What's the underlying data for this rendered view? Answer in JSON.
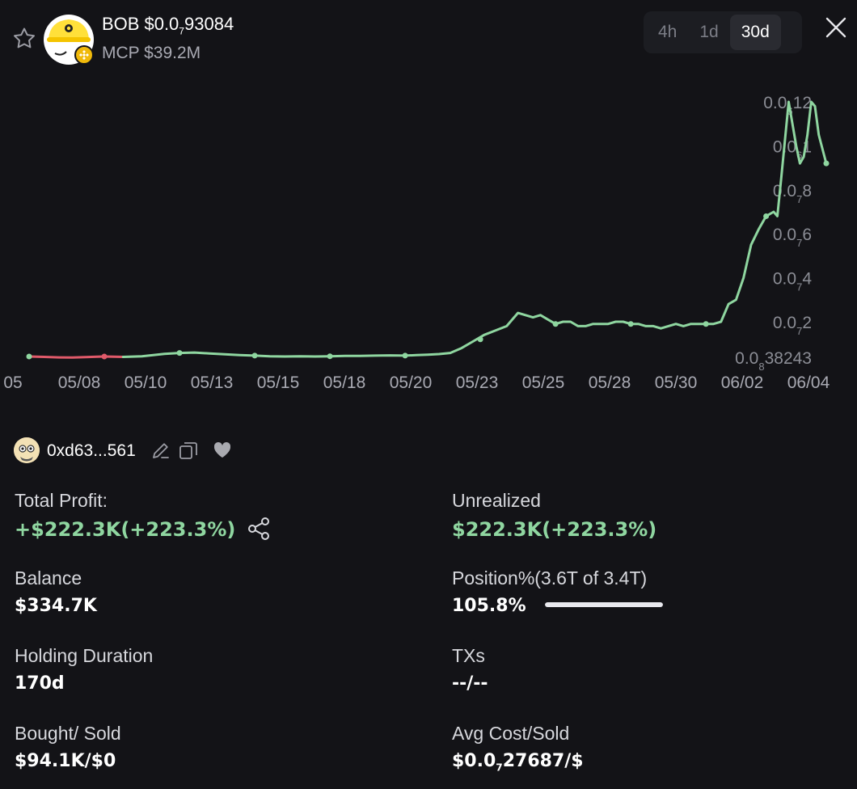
{
  "token": {
    "symbol": "BOB",
    "price_prefix": "$0.0",
    "price_sub": "7",
    "price_rest": "93084",
    "mcp": "MCP $39.2M"
  },
  "timeframes": [
    "4h",
    "1d",
    "30d"
  ],
  "active_timeframe": "30d",
  "colors": {
    "up": "#8fd6a0",
    "down": "#e05a6a",
    "background": "#131317"
  },
  "chart_data": {
    "type": "line",
    "x_tick_labels": [
      "05",
      "05/08",
      "05/10",
      "05/13",
      "05/15",
      "05/18",
      "05/20",
      "05/23",
      "05/25",
      "05/28",
      "05/30",
      "06/02",
      "06/04"
    ],
    "y_tick_labels": [
      {
        "prefix": "0.0",
        "sub": "6",
        "rest": "12",
        "value": 1.2e-07
      },
      {
        "prefix": "0.0",
        "sub": "6",
        "rest": "1",
        "value": 1e-07
      },
      {
        "prefix": "0.0",
        "sub": "7",
        "rest": "8",
        "value": 8e-08
      },
      {
        "prefix": "0.0",
        "sub": "7",
        "rest": "6",
        "value": 6e-08
      },
      {
        "prefix": "0.0",
        "sub": "7",
        "rest": "4",
        "value": 4e-08
      },
      {
        "prefix": "0.0",
        "sub": "7",
        "rest": "2",
        "value": 2e-08
      }
    ],
    "min_label": {
      "prefix": "0.0",
      "sub": "8",
      "rest": "38243",
      "value": 3.8243e-09
    },
    "ylim": [
      3.8243e-09,
      1.2e-07
    ],
    "series": [
      {
        "color_role": "down",
        "points": [
          [
            0,
            4.2e-09
          ],
          [
            4,
            4e-09
          ],
          [
            8,
            3.8e-09
          ],
          [
            11.5,
            3.7e-09
          ],
          [
            15,
            3.9e-09
          ],
          [
            20,
            4.2e-09
          ],
          [
            25,
            4e-09
          ]
        ]
      },
      {
        "color_role": "up",
        "points": [
          [
            25,
            4e-09
          ],
          [
            30,
            4.3e-09
          ],
          [
            33,
            4.8e-09
          ],
          [
            36,
            5.4e-09
          ],
          [
            40,
            5.8e-09
          ],
          [
            44,
            6e-09
          ],
          [
            48,
            5.6e-09
          ],
          [
            52,
            5.2e-09
          ],
          [
            56,
            4.8e-09
          ],
          [
            60,
            4.6e-09
          ],
          [
            64,
            4.3e-09
          ],
          [
            68,
            4.2e-09
          ],
          [
            72,
            4.3e-09
          ],
          [
            76,
            4.2e-09
          ],
          [
            80,
            4.3e-09
          ],
          [
            84,
            4.5e-09
          ],
          [
            88,
            4.5e-09
          ],
          [
            92,
            4.6e-09
          ],
          [
            96,
            4.7e-09
          ],
          [
            100,
            4.6e-09
          ],
          [
            103,
            4.8e-09
          ],
          [
            106,
            5e-09
          ],
          [
            109,
            5.3e-09
          ],
          [
            112,
            5.8e-09
          ],
          [
            115,
            8e-09
          ],
          [
            118,
            1.1e-08
          ],
          [
            121,
            1.4e-08
          ],
          [
            124,
            1.6e-08
          ],
          [
            127,
            1.8e-08
          ],
          [
            130,
            2.4e-08
          ],
          [
            132,
            2.3e-08
          ],
          [
            134,
            2.2e-08
          ],
          [
            136,
            2.3e-08
          ],
          [
            138,
            2.1e-08
          ],
          [
            140,
            1.9e-08
          ],
          [
            142,
            2e-08
          ],
          [
            144,
            2e-08
          ],
          [
            146,
            1.8e-08
          ],
          [
            148,
            1.8e-08
          ],
          [
            150,
            1.9e-08
          ],
          [
            152,
            1.9e-08
          ],
          [
            154,
            1.9e-08
          ],
          [
            156,
            2e-08
          ],
          [
            158,
            2e-08
          ],
          [
            160,
            1.9e-08
          ],
          [
            162,
            1.9e-08
          ],
          [
            164,
            1.8e-08
          ],
          [
            166,
            1.8e-08
          ],
          [
            168,
            1.7e-08
          ],
          [
            170,
            1.8e-08
          ],
          [
            172,
            1.9e-08
          ],
          [
            174,
            1.8e-08
          ],
          [
            176,
            1.9e-08
          ],
          [
            178,
            1.9e-08
          ],
          [
            180,
            1.9e-08
          ],
          [
            182,
            1.9e-08
          ],
          [
            184,
            2e-08
          ],
          [
            186,
            2.8e-08
          ],
          [
            188,
            3e-08
          ],
          [
            190,
            4e-08
          ],
          [
            192,
            5.5e-08
          ],
          [
            194,
            6.2e-08
          ],
          [
            196,
            6.8e-08
          ],
          [
            198,
            7e-08
          ],
          [
            199,
            6.8e-08
          ],
          [
            200,
            8.5e-08
          ],
          [
            202,
            1.2e-07
          ],
          [
            204,
            1e-07
          ],
          [
            205,
            9.2e-08
          ],
          [
            206,
            9.5e-08
          ],
          [
            207,
            1.05e-07
          ],
          [
            208,
            1.2e-07
          ],
          [
            209,
            1.18e-07
          ],
          [
            210,
            1.05e-07
          ],
          [
            212,
            9.2e-08
          ]
        ]
      }
    ],
    "xlim": [
      0,
      212
    ],
    "markers": [
      [
        0,
        4.2e-09
      ],
      [
        20,
        4.2e-09
      ],
      [
        40,
        5.8e-09
      ],
      [
        60,
        4.6e-09
      ],
      [
        80,
        4.3e-09
      ],
      [
        100,
        4.6e-09
      ],
      [
        120,
        1.2e-08
      ],
      [
        140,
        1.9e-08
      ],
      [
        160,
        1.9e-08
      ],
      [
        180,
        1.9e-08
      ],
      [
        196,
        6.8e-08
      ],
      [
        212,
        9.2e-08
      ]
    ]
  },
  "wallet": {
    "address": "0xd63...561"
  },
  "stats": {
    "total_profit_label": "Total Profit:",
    "total_profit_value": "+$222.3K(+223.3%)",
    "unrealized_label": "Unrealized",
    "unrealized_value": "$222.3K(+223.3%)",
    "balance_label": "Balance",
    "balance_value": "$334.7K",
    "position_label": "Position%(3.6T of 3.4T)",
    "position_value": "105.8%",
    "position_fill_pct": 100,
    "holding_label": "Holding Duration",
    "holding_value": "170d",
    "txs_label": "TXs",
    "txs_value": "--/--",
    "bought_sold_label": "Bought/ Sold",
    "bought_sold_value": "$94.1K/$0",
    "avg_cost_label": "Avg Cost/Sold",
    "avg_cost_prefix": "$0.0",
    "avg_cost_sub": "7",
    "avg_cost_rest": "27687/$"
  }
}
